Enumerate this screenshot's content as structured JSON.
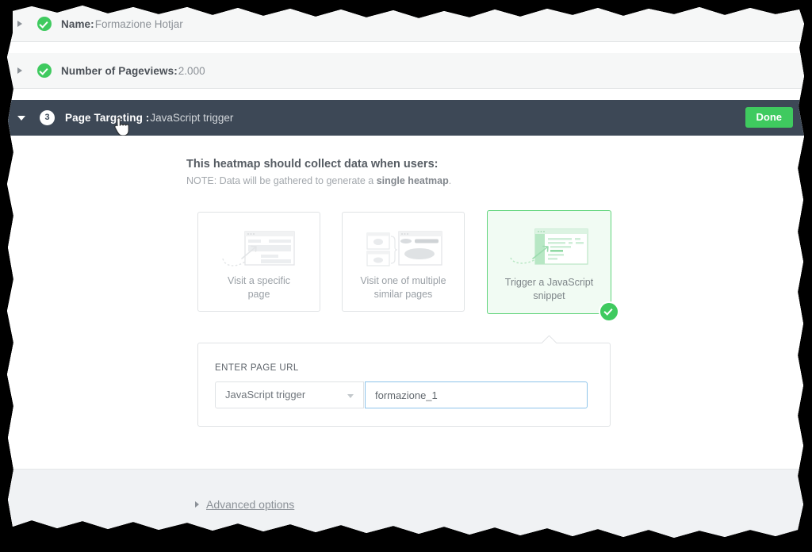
{
  "steps": [
    {
      "label": "Name:",
      "value": " Formazione Hotjar",
      "state": "complete",
      "icon": "check-circle-icon"
    },
    {
      "label": "Number of Pageviews:",
      "value": " 2.000",
      "state": "complete",
      "icon": "check-circle-icon"
    }
  ],
  "active_step": {
    "number": "3",
    "label": "Page Targeting :",
    "value": " JavaScript trigger",
    "done_label": "Done"
  },
  "main": {
    "headline": "This heatmap should collect data when users:",
    "note_prefix": "NOTE: Data will be gathered to generate a ",
    "note_bold": "single heatmap",
    "note_suffix": ".",
    "cards": [
      {
        "caption_line1": "Visit a specific",
        "caption_line2": "page",
        "selected": false,
        "icon": "single-page-icon"
      },
      {
        "caption_line1": "Visit one of multiple",
        "caption_line2": "similar pages",
        "selected": false,
        "icon": "multiple-pages-icon"
      },
      {
        "caption_line1": "Trigger a JavaScript",
        "caption_line2": "snippet",
        "selected": true,
        "icon": "javascript-snippet-icon"
      }
    ]
  },
  "url_panel": {
    "label": "ENTER PAGE URL",
    "select_value": "JavaScript trigger",
    "input_value": "formazione_1",
    "input_placeholder": ""
  },
  "footer": {
    "advanced_label": "Advanced options"
  },
  "colors": {
    "accent_green": "#3fca5f",
    "header_dark": "#3d4856",
    "card_selected_border": "#5fd47a",
    "card_selected_bg": "#f1fbf3",
    "input_focus_border": "#8ec4ea",
    "footer_bg": "#f0f2f4"
  }
}
